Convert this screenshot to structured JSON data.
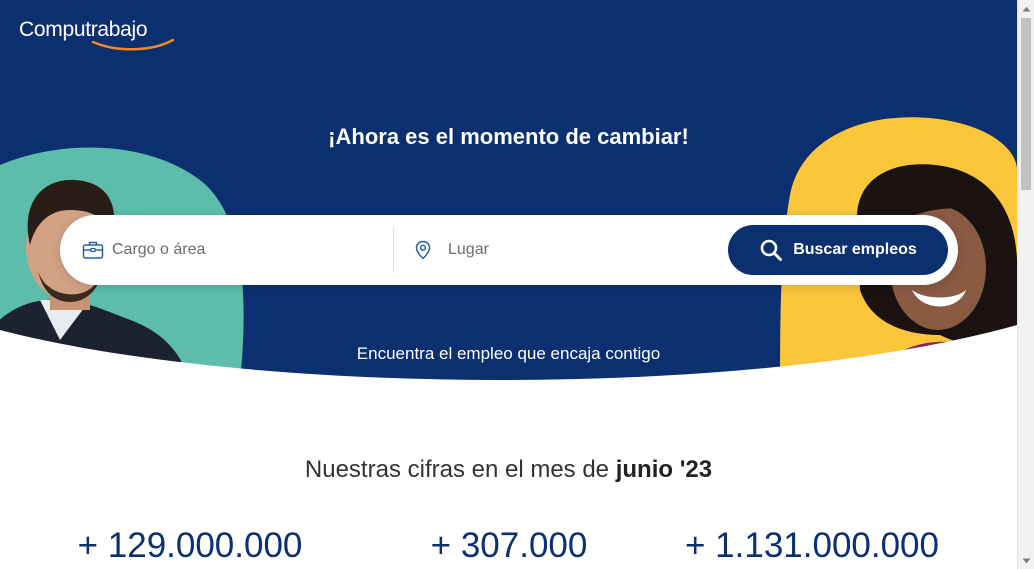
{
  "brand": {
    "logo_text": "Computrabajo"
  },
  "colors": {
    "navy": "#0c2f70",
    "teal": "#5bbdaa",
    "yellow": "#fbc63a",
    "swoosh": "#f08a24"
  },
  "hero": {
    "title": "¡Ahora es el momento de cambiar!",
    "subtitle": "Encuentra el empleo que encaja contigo"
  },
  "search": {
    "what_placeholder": "Cargo o área",
    "what_icon": "briefcase-icon",
    "where_placeholder": "Lugar",
    "where_icon": "location-pin-icon",
    "button_label": "Buscar empleos",
    "button_icon": "search-icon"
  },
  "stats": {
    "title_prefix": "Nuestras cifras en el mes de",
    "title_month": "junio '23",
    "numbers": [
      "+ 129.000.000",
      "+ 307.000",
      "+ 1.131.000.000"
    ]
  }
}
